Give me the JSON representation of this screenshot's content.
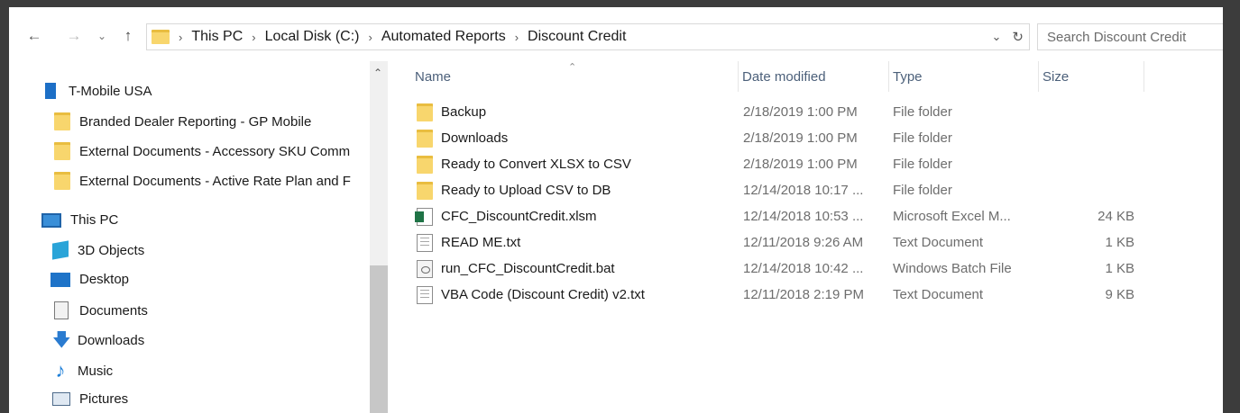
{
  "address_bar": {
    "breadcrumbs": [
      "This PC",
      "Local Disk (C:)",
      "Automated Reports",
      "Discount Credit"
    ],
    "search_placeholder": "Search Discount Credit"
  },
  "nav_pane": {
    "items": [
      {
        "label": "T-Mobile USA",
        "icon": "building-icon"
      },
      {
        "label": "Branded Dealer Reporting - GP Mobile",
        "icon": "folder-icon"
      },
      {
        "label": "External Documents - Accessory SKU Comm",
        "icon": "folder-icon"
      },
      {
        "label": "External Documents - Active Rate Plan and F",
        "icon": "folder-icon"
      },
      {
        "label": "This PC",
        "icon": "this-pc-icon"
      },
      {
        "label": "3D Objects",
        "icon": "3d-objects-icon"
      },
      {
        "label": "Desktop",
        "icon": "desktop-icon"
      },
      {
        "label": "Documents",
        "icon": "documents-icon"
      },
      {
        "label": "Downloads",
        "icon": "downloads-icon"
      },
      {
        "label": "Music",
        "icon": "music-icon"
      },
      {
        "label": "Pictures",
        "icon": "pictures-icon"
      }
    ]
  },
  "file_list": {
    "columns": {
      "name": "Name",
      "date": "Date modified",
      "type": "Type",
      "size": "Size"
    },
    "rows": [
      {
        "name": "Backup",
        "date": "2/18/2019 1:00 PM",
        "type": "File folder",
        "size": "",
        "icon": "folder-icon"
      },
      {
        "name": "Downloads",
        "date": "2/18/2019 1:00 PM",
        "type": "File folder",
        "size": "",
        "icon": "folder-icon"
      },
      {
        "name": "Ready to Convert XLSX to CSV",
        "date": "2/18/2019 1:00 PM",
        "type": "File folder",
        "size": "",
        "icon": "folder-icon"
      },
      {
        "name": "Ready to Upload CSV to DB",
        "date": "12/14/2018 10:17 ...",
        "type": "File folder",
        "size": "",
        "icon": "folder-icon"
      },
      {
        "name": "CFC_DiscountCredit.xlsm",
        "date": "12/14/2018 10:53 ...",
        "type": "Microsoft Excel M...",
        "size": "24 KB",
        "icon": "excel-file-icon"
      },
      {
        "name": "READ ME.txt",
        "date": "12/11/2018 9:26 AM",
        "type": "Text Document",
        "size": "1 KB",
        "icon": "text-file-icon"
      },
      {
        "name": "run_CFC_DiscountCredit.bat",
        "date": "12/14/2018 10:42 ...",
        "type": "Windows Batch File",
        "size": "1 KB",
        "icon": "batch-file-icon"
      },
      {
        "name": "VBA Code (Discount Credit) v2.txt",
        "date": "12/11/2018 2:19 PM",
        "type": "Text Document",
        "size": "9 KB",
        "icon": "text-file-icon"
      }
    ]
  }
}
